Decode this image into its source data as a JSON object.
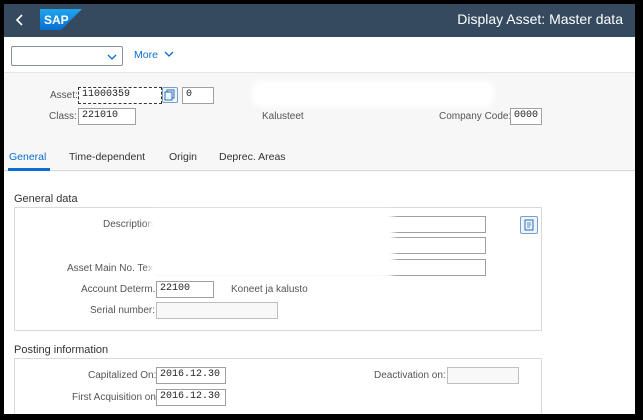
{
  "shell": {
    "back_icon": "chevron-left-icon",
    "logo_text": "SAP",
    "title": "Display Asset:  Master data",
    "brand_color": "#354a5f"
  },
  "toolbar": {
    "dropdown_value": "",
    "more_label": "More"
  },
  "header": {
    "asset_label": "Asset:",
    "asset_value": "11000359",
    "asset_sub_value": "0",
    "class_label": "Class:",
    "class_value": "221010",
    "class_desc": "Kalusteet",
    "company_code_label": "Company Code:",
    "company_code_value": "0000"
  },
  "tabs": [
    "General",
    "Time-dependent",
    "Origin",
    "Deprec. Areas"
  ],
  "general_data": {
    "title": "General data",
    "description_label": "Description",
    "main_no_text_label": "Asset Main No. Tex",
    "account_determ_label": "Account Determ.:",
    "account_determ_value": "22100",
    "account_determ_desc": "Koneet ja kalusto",
    "serial_label": "Serial number:",
    "serial_value": ""
  },
  "posting": {
    "title": "Posting information",
    "capitalized_label": "Capitalized On:",
    "capitalized_value": "2016.12.30",
    "first_acq_label": "First Acquisition on:",
    "first_acq_value": "2016.12.30",
    "deactivation_label": "Deactivation on:",
    "deactivation_value": ""
  }
}
